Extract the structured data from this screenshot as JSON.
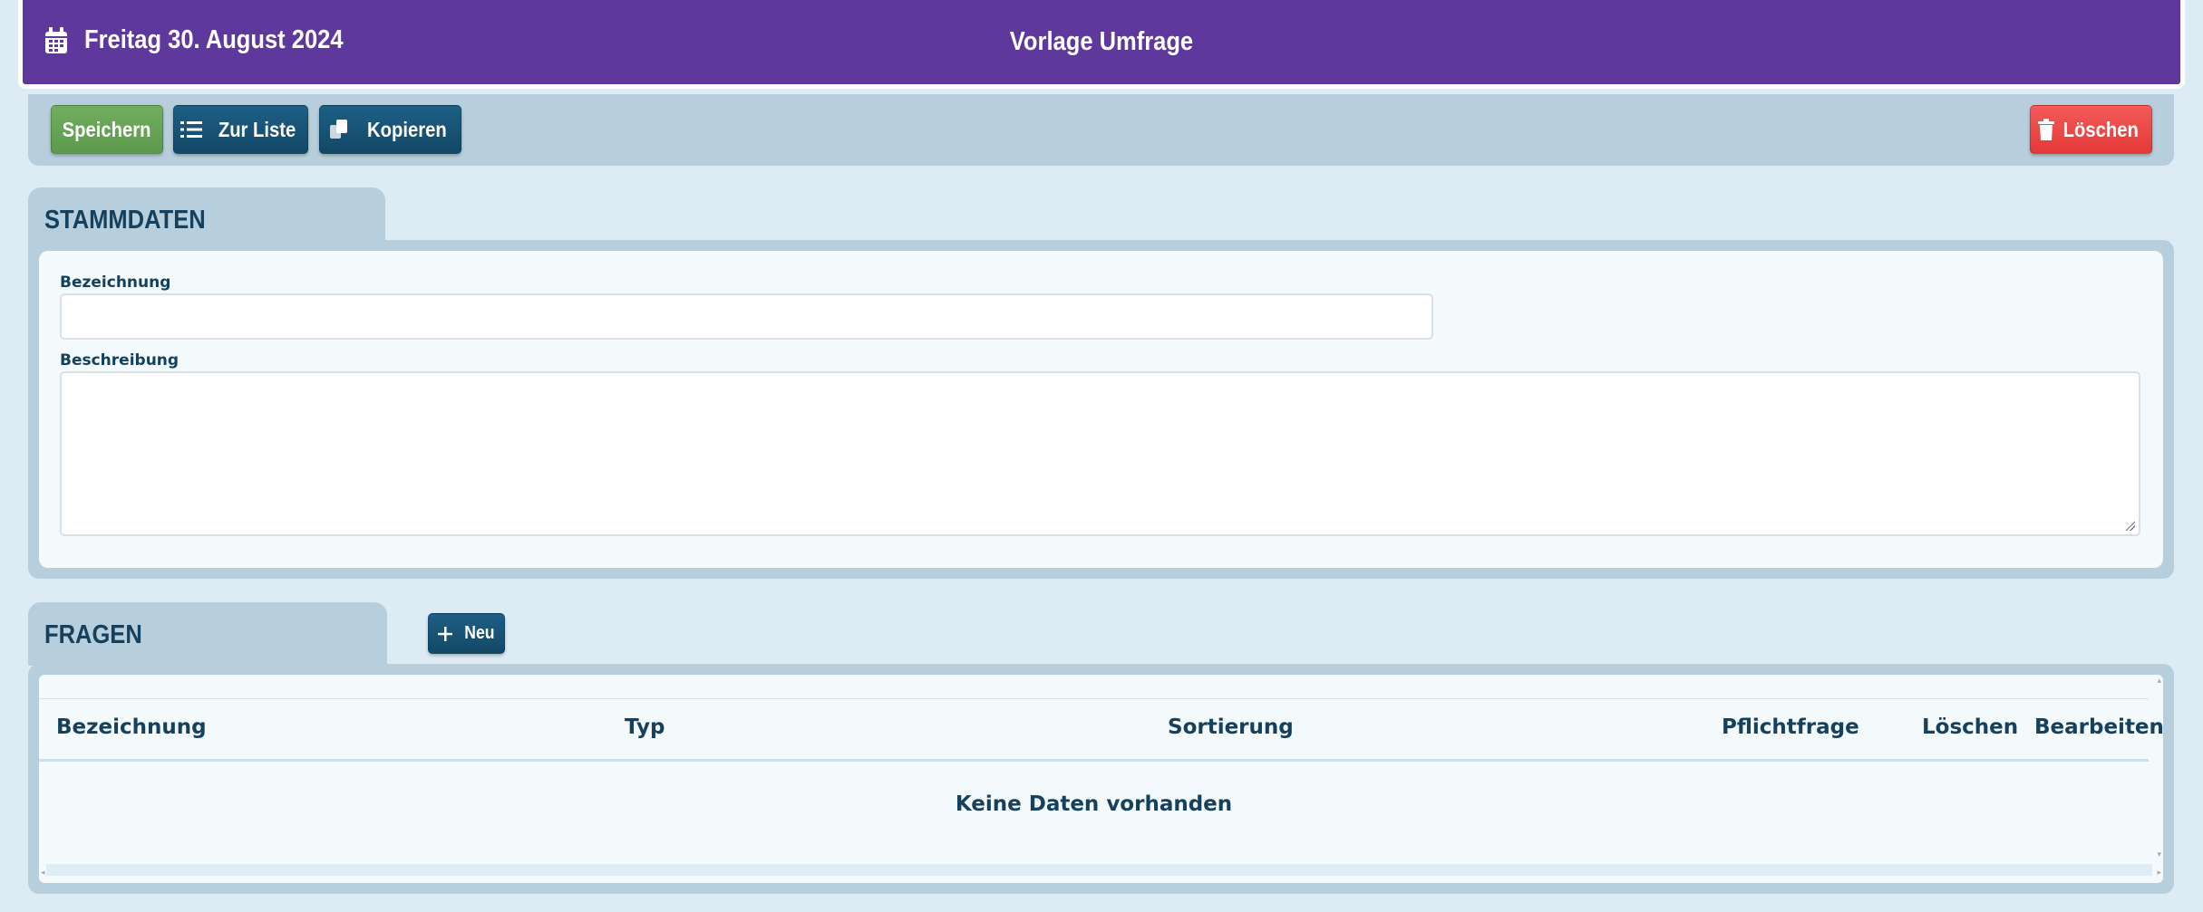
{
  "header": {
    "date": "Freitag 30. August 2024",
    "title": "Vorlage Umfrage",
    "date_icon": "calendar-icon",
    "bg_color": "#5e389c"
  },
  "toolbar": {
    "save_label": "Speichern",
    "list_label": "Zur Liste",
    "copy_label": "Kopieren",
    "delete_label": "Löschen",
    "list_icon": "list-icon",
    "copy_icon": "copy-icon",
    "delete_icon": "trash-icon"
  },
  "stammdaten": {
    "tab_label": "STAMMDATEN",
    "bezeichnung_label": "Bezeichnung",
    "bezeichnung_value": "",
    "beschreibung_label": "Beschreibung",
    "beschreibung_value": ""
  },
  "fragen": {
    "tab_label": "FRAGEN",
    "new_label": "Neu",
    "new_icon": "plus-icon",
    "columns": [
      "Bezeichnung",
      "Typ",
      "Sortierung",
      "Pflichtfrage",
      "Löschen",
      "Bearbeiten"
    ],
    "empty_text": "Keine Daten vorhanden"
  },
  "colors": {
    "save": "#65a354",
    "primary": "#1a587d",
    "danger": "#ec4745",
    "panel": "#b7cfdc",
    "background": "#dcebf4"
  }
}
